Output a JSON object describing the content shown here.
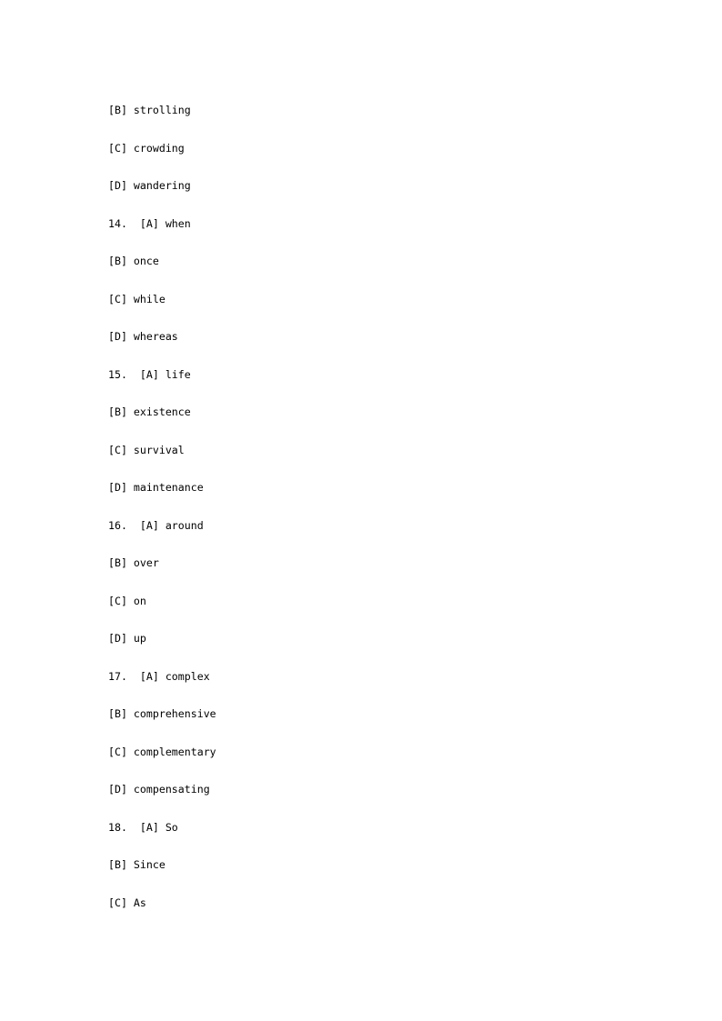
{
  "document": {
    "page_background": "#ffffff",
    "text_color": "#000000",
    "lines": [
      {
        "id": "q13-opt-b",
        "text": "[B] strolling"
      },
      {
        "id": "q13-opt-c",
        "text": "[C] crowding"
      },
      {
        "id": "q13-opt-d",
        "text": "[D] wandering"
      },
      {
        "id": "q14-opt-a",
        "text": "14.  [A] when"
      },
      {
        "id": "q14-opt-b",
        "text": "[B] once"
      },
      {
        "id": "q14-opt-c",
        "text": "[C] while"
      },
      {
        "id": "q14-opt-d",
        "text": "[D] whereas"
      },
      {
        "id": "q15-opt-a",
        "text": "15.  [A] life"
      },
      {
        "id": "q15-opt-b",
        "text": "[B] existence"
      },
      {
        "id": "q15-opt-c",
        "text": "[C] survival"
      },
      {
        "id": "q15-opt-d",
        "text": "[D] maintenance"
      },
      {
        "id": "q16-opt-a",
        "text": "16.  [A] around"
      },
      {
        "id": "q16-opt-b",
        "text": "[B] over"
      },
      {
        "id": "q16-opt-c",
        "text": "[C] on"
      },
      {
        "id": "q16-opt-d",
        "text": "[D] up"
      },
      {
        "id": "q17-opt-a",
        "text": "17.  [A] complex"
      },
      {
        "id": "q17-opt-b",
        "text": "[B] comprehensive"
      },
      {
        "id": "q17-opt-c",
        "text": "[C] complementary"
      },
      {
        "id": "q17-opt-d",
        "text": "[D] compensating"
      },
      {
        "id": "q18-opt-a",
        "text": "18.  [A] So"
      },
      {
        "id": "q18-opt-b",
        "text": "[B] Since"
      },
      {
        "id": "q18-opt-c",
        "text": "[C] As"
      }
    ]
  }
}
